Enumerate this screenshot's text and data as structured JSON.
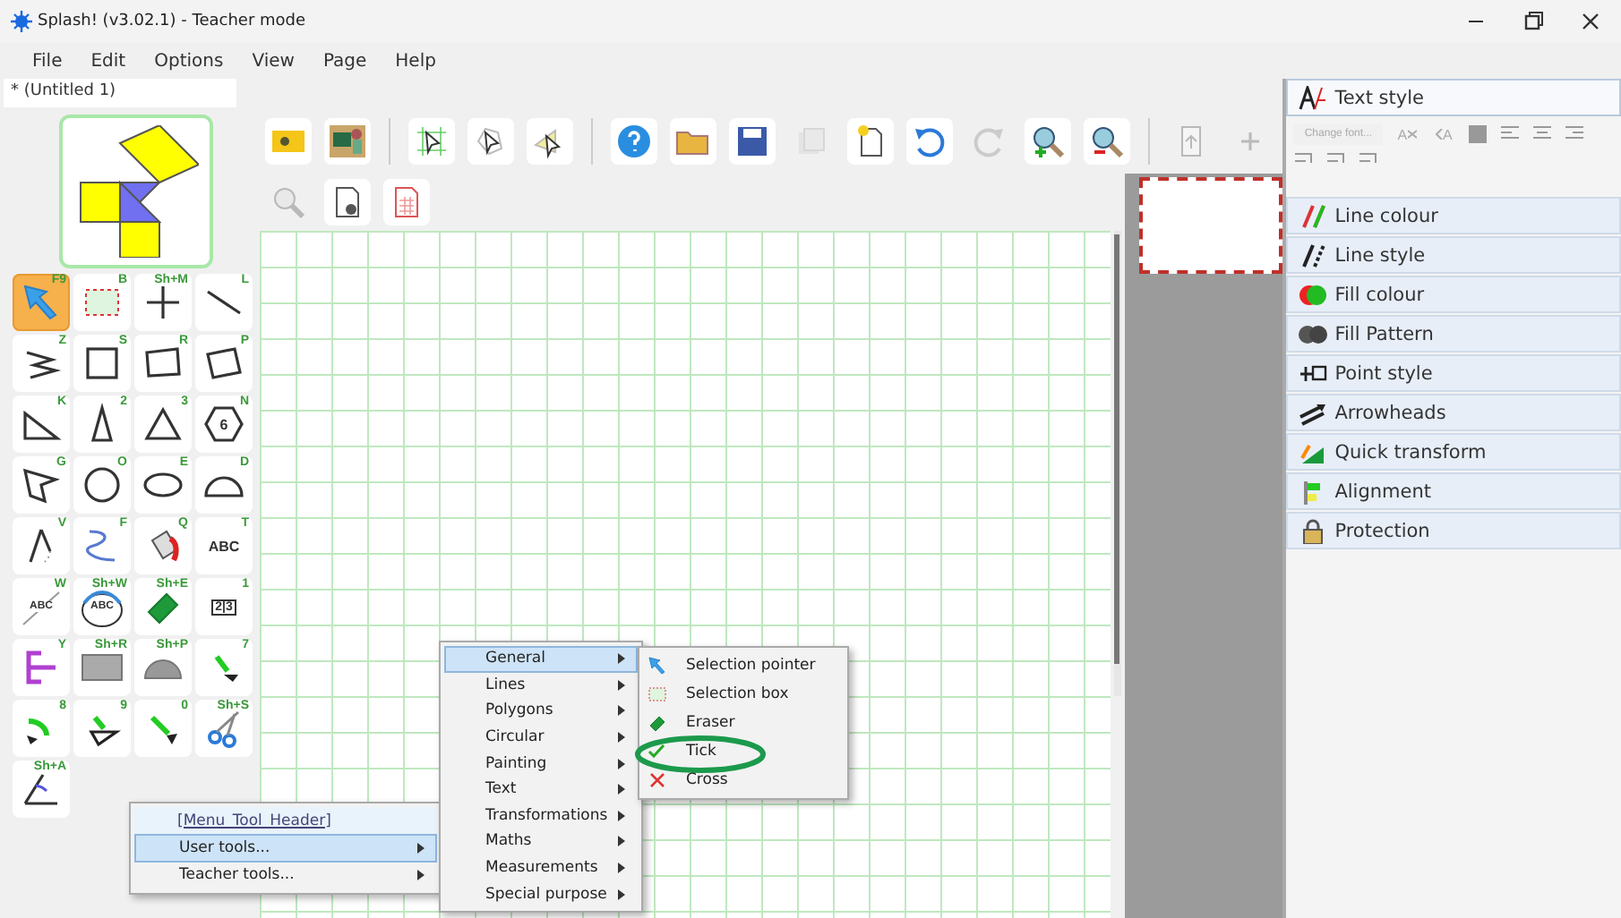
{
  "window": {
    "title": "Splash! (v3.02.1) - Teacher mode"
  },
  "menu_bar": [
    "File",
    "Edit",
    "Options",
    "View",
    "Page",
    "Help"
  ],
  "document_tab": {
    "label": "* (Untitled 1)"
  },
  "tools": [
    {
      "kind": "pointer",
      "shortcut": "F9",
      "selected": true
    },
    {
      "kind": "selbox",
      "shortcut": "B",
      "selected": false
    },
    {
      "kind": "point",
      "shortcut": "Sh+M",
      "selected": false
    },
    {
      "kind": "line",
      "shortcut": "L",
      "selected": false
    },
    {
      "kind": "zigzag",
      "shortcut": "Z",
      "selected": false
    },
    {
      "kind": "square",
      "shortcut": "S",
      "selected": false
    },
    {
      "kind": "rectangle",
      "shortcut": "R",
      "selected": false
    },
    {
      "kind": "parallelogram",
      "shortcut": "P",
      "selected": false
    },
    {
      "kind": "righttriangle",
      "shortcut": "K",
      "selected": false
    },
    {
      "kind": "isosceles",
      "shortcut": "2",
      "selected": false
    },
    {
      "kind": "equilateral",
      "shortcut": "3",
      "selected": false
    },
    {
      "kind": "hexagon",
      "shortcut": "N",
      "label": "6",
      "selected": false
    },
    {
      "kind": "polygon",
      "shortcut": "G",
      "selected": false
    },
    {
      "kind": "circle",
      "shortcut": "O",
      "selected": false
    },
    {
      "kind": "ellipse",
      "shortcut": "E",
      "selected": false
    },
    {
      "kind": "semicircle",
      "shortcut": "D",
      "selected": false
    },
    {
      "kind": "compass",
      "shortcut": "V",
      "selected": false
    },
    {
      "kind": "freehand",
      "shortcut": "F",
      "selected": false
    },
    {
      "kind": "bucket",
      "shortcut": "Q",
      "selected": false
    },
    {
      "kind": "text",
      "shortcut": "T",
      "label": "ABC",
      "selected": false
    },
    {
      "kind": "slanttext",
      "shortcut": "W",
      "label": "ABC",
      "selected": false
    },
    {
      "kind": "circletext",
      "shortcut": "Sh+W",
      "label": "ABC",
      "selected": false
    },
    {
      "kind": "eraser",
      "shortcut": "Sh+E",
      "selected": false
    },
    {
      "kind": "numbers",
      "shortcut": "1",
      "label": "2|3",
      "selected": false
    },
    {
      "kind": "bracket",
      "shortcut": "Y",
      "selected": false
    },
    {
      "kind": "ruler",
      "shortcut": "Sh+R",
      "selected": false
    },
    {
      "kind": "protractor",
      "shortcut": "Sh+P",
      "selected": false
    },
    {
      "kind": "translate",
      "shortcut": "7",
      "selected": false
    },
    {
      "kind": "rotate",
      "shortcut": "8",
      "selected": false
    },
    {
      "kind": "reflect",
      "shortcut": "9",
      "selected": false
    },
    {
      "kind": "enlarge",
      "shortcut": "0",
      "selected": false
    },
    {
      "kind": "scissors",
      "shortcut": "Sh+S",
      "selected": false
    },
    {
      "kind": "angle",
      "shortcut": "Sh+A",
      "selected": false
    }
  ],
  "toolbar": {
    "row_1": [
      {
        "kind": "photo",
        "disabled": false
      },
      {
        "kind": "teacher",
        "disabled": false
      },
      {
        "kind": "separator"
      },
      {
        "kind": "selectgrid",
        "disabled": false
      },
      {
        "kind": "selectshape",
        "disabled": false
      },
      {
        "kind": "selectarrow",
        "disabled": false
      },
      {
        "kind": "separator"
      },
      {
        "kind": "help",
        "disabled": false
      },
      {
        "kind": "open",
        "disabled": false
      },
      {
        "kind": "save",
        "disabled": false
      },
      {
        "kind": "copy",
        "disabled": true
      },
      {
        "kind": "newpage",
        "disabled": false
      },
      {
        "kind": "undo",
        "disabled": false
      },
      {
        "kind": "redo",
        "disabled": true
      },
      {
        "kind": "zoomin",
        "disabled": false
      },
      {
        "kind": "zoomout",
        "disabled": false
      },
      {
        "kind": "separator"
      },
      {
        "kind": "pageup",
        "disabled": true
      },
      {
        "kind": "add",
        "disabled": true
      }
    ],
    "row_2": [
      {
        "kind": "find",
        "disabled": true
      },
      {
        "kind": "pagesetup",
        "disabled": false
      },
      {
        "kind": "gridpage",
        "disabled": false
      }
    ]
  },
  "right_panel": {
    "sections": [
      {
        "label": "Text style",
        "expanded": true
      },
      {
        "label": "Line colour",
        "expanded": false
      },
      {
        "label": "Line style",
        "expanded": false
      },
      {
        "label": "Fill colour",
        "expanded": false
      },
      {
        "label": "Fill Pattern",
        "expanded": false
      },
      {
        "label": "Point style",
        "expanded": false
      },
      {
        "label": "Arrowheads",
        "expanded": false
      },
      {
        "label": "Quick transform",
        "expanded": false
      },
      {
        "label": "Alignment",
        "expanded": false
      },
      {
        "label": "Protection",
        "expanded": false
      }
    ],
    "text_style": {
      "font_button": "Change font...",
      "shrink_label": "A",
      "grow_label": "A"
    }
  },
  "context_menu": {
    "header": "[Menu_Tool_Header]",
    "items": [
      {
        "label": "User tools...",
        "selected": true
      },
      {
        "label": "Teacher tools...",
        "selected": false
      }
    ]
  },
  "submenu": {
    "items": [
      {
        "label": "General",
        "selected": true
      },
      {
        "label": "Lines",
        "selected": false
      },
      {
        "label": "Polygons",
        "selected": false
      },
      {
        "label": "Circular",
        "selected": false
      },
      {
        "label": "Painting",
        "selected": false
      },
      {
        "label": "Text",
        "selected": false
      },
      {
        "label": "Transformations",
        "selected": false
      },
      {
        "label": "Maths",
        "selected": false
      },
      {
        "label": "Measurements",
        "selected": false
      },
      {
        "label": "Special purpose",
        "selected": false
      }
    ]
  },
  "tool_submenu": {
    "items": [
      {
        "kind": "pointer",
        "label": "Selection pointer"
      },
      {
        "kind": "selbox",
        "label": "Selection box"
      },
      {
        "kind": "eraser",
        "label": "Eraser"
      },
      {
        "kind": "tick",
        "label": "Tick"
      },
      {
        "kind": "cross",
        "label": "Cross"
      }
    ]
  }
}
